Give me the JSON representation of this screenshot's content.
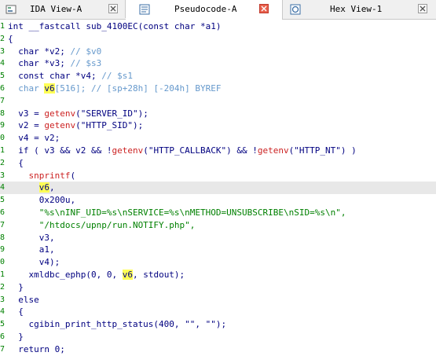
{
  "tabs": [
    {
      "label": "IDA View-A",
      "active": false
    },
    {
      "label": "Pseudocode-A",
      "active": true
    },
    {
      "label": "Hex View-1",
      "active": false
    }
  ],
  "gutter": [
    "1",
    "2",
    "3",
    "4",
    "5",
    "6",
    "7",
    "8",
    "9",
    "0",
    "1",
    "2",
    "3",
    "4",
    "5",
    "6",
    "7",
    "8",
    "9",
    "0",
    "1",
    "2",
    "3",
    "4",
    "5",
    "6",
    "7"
  ],
  "code": {
    "l1": "int __fastcall sub_4100EC(const char *a1)",
    "l2": "{",
    "l3_a": "  char *v2; ",
    "l3_c": "// $v0",
    "l4_a": "  char *v3; ",
    "l4_c": "// $s3",
    "l5_a": "  const char *v4; ",
    "l5_c": "// $s1",
    "l6_a": "  char ",
    "l6_v": "v6",
    "l6_b": "[516]; ",
    "l6_c": "// [sp+28h] [-204h] BYREF",
    "l7": "",
    "l8_a": "  v3 = ",
    "l8_f": "getenv",
    "l8_s": "(\"SERVER_ID\");",
    "l9_a": "  v2 = ",
    "l9_f": "getenv",
    "l9_s": "(\"HTTP_SID\");",
    "l10": "  v4 = v2;",
    "l11_a": "  if ( v3 && v2 && !",
    "l11_f1": "getenv",
    "l11_s1": "(\"HTTP_CALLBACK\")",
    "l11_m": " && !",
    "l11_f2": "getenv",
    "l11_s2": "(\"HTTP_NT\")",
    "l11_e": " )",
    "l12": "  {",
    "l13_f": "    snprintf",
    "l13_e": "(",
    "l14_a": "      ",
    "l14_v": "v6",
    "l14_e": ",",
    "l15": "      0x200u,",
    "l16": "      \"%s\\nINF_UID=%s\\nSERVICE=%s\\nMETHOD=UNSUBSCRIBE\\nSID=%s\\n\",",
    "l17": "      \"/htdocs/upnp/run.NOTIFY.php\",",
    "l18": "      v3,",
    "l19": "      a1,",
    "l20": "      v4);",
    "l21_a": "    xmldbc_ephp(0, 0, ",
    "l21_v": "v6",
    "l21_e": ", stdout);",
    "l22": "  }",
    "l23": "  else",
    "l24": "  {",
    "l25": "    cgibin_print_http_status(400, \"\", \"\");",
    "l26": "  }",
    "l27": "  return 0;"
  },
  "colors": {
    "keyword": "#000080",
    "function": "#cc2222",
    "comment": "#6699cc",
    "string": "#008000",
    "highlight": "#ffff55"
  }
}
